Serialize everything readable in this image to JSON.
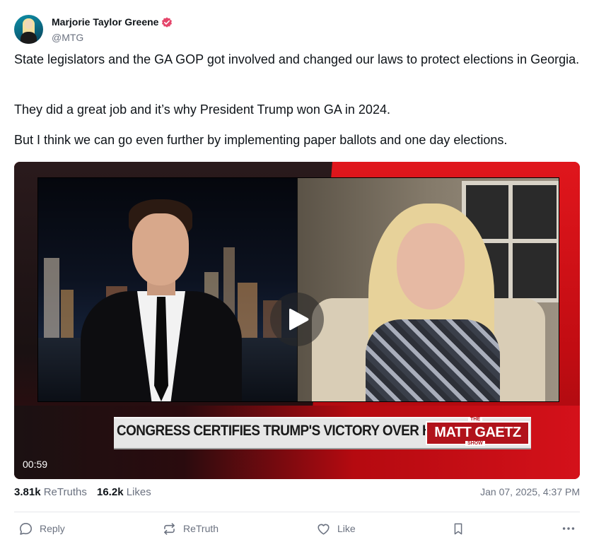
{
  "author": {
    "name": "Marjorie Taylor Greene",
    "handle": "@MTG",
    "verified": true,
    "badge_color": "#e5466b"
  },
  "post": {
    "paragraphs": [
      "State legislators and the GA GOP got involved and changed our laws to protect elections in Georgia.",
      "They did a great job and it’s why President Trump won GA in 2024.",
      "But I think we can go even further by implementing paper ballots and one day elections."
    ]
  },
  "video": {
    "duration": "00:59",
    "lower_third": "CONGRESS CERTIFIES TRUMP'S VICTORY OVER HARRIS",
    "show_logo": {
      "top": "THE",
      "name": "MATT GAETZ",
      "bottom": "SHOW"
    }
  },
  "stats": {
    "retruths_count": "3.81k",
    "retruths_label": "ReTruths",
    "likes_count": "16.2k",
    "likes_label": "Likes",
    "timestamp": "Jan 07, 2025, 4:37 PM"
  },
  "actions": {
    "reply": "Reply",
    "retruth": "ReTruth",
    "like": "Like"
  },
  "icons": {
    "reply": "speech-bubble-icon",
    "retruth": "repost-arrows-icon",
    "like": "heart-icon",
    "bookmark": "bookmark-icon",
    "more": "ellipsis-icon"
  }
}
